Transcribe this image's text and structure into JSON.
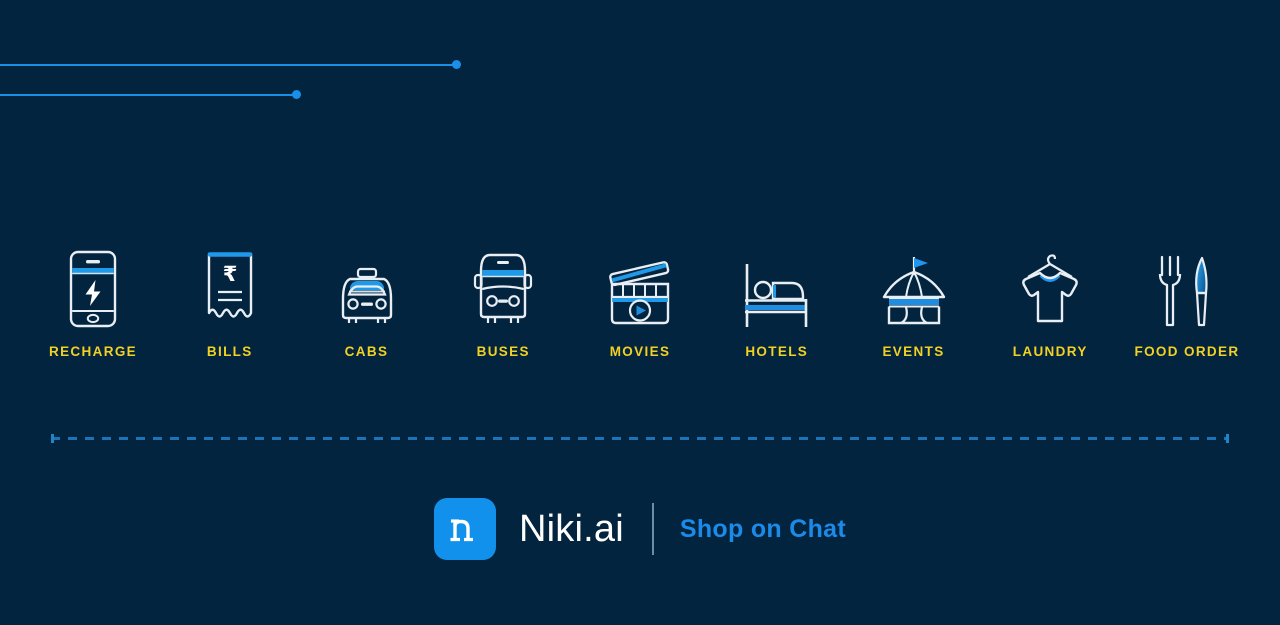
{
  "page": {
    "background_color": "#02243e",
    "accent_blue": "#1a8fe8",
    "label_yellow": "#f2d024",
    "icon_stroke": "#e8eef3"
  },
  "decor": {
    "top_lines": [
      {
        "name": "deco-line-1",
        "length": 455,
        "dot": true
      },
      {
        "name": "deco-line-2",
        "length": 294,
        "dot": true
      }
    ],
    "dashed_separator": {
      "name": "dashed-separator",
      "color": "#1c73b5"
    }
  },
  "services": [
    {
      "id": "recharge",
      "label": "RECHARGE",
      "icon": "mobile-phone-lightning-icon"
    },
    {
      "id": "bills",
      "label": "BILLS",
      "icon": "receipt-rupee-icon"
    },
    {
      "id": "cabs",
      "label": "CABS",
      "icon": "taxi-front-icon"
    },
    {
      "id": "buses",
      "label": "BUSES",
      "icon": "bus-front-icon"
    },
    {
      "id": "movies",
      "label": "MOVIES",
      "icon": "clapperboard-play-icon"
    },
    {
      "id": "hotels",
      "label": "HOTELS",
      "icon": "bed-person-icon"
    },
    {
      "id": "events",
      "label": "EVENTS",
      "icon": "circus-tent-flag-icon"
    },
    {
      "id": "laundry",
      "label": "LAUNDRY",
      "icon": "tshirt-hanger-icon"
    },
    {
      "id": "food_order",
      "label": "FOOD ORDER",
      "icon": "fork-knife-icon"
    }
  ],
  "brand": {
    "logo_glyph": "n",
    "logo_icon": "niki-n-mark-icon",
    "logo_bg": "#1191ec",
    "name": "Niki.ai",
    "tagline": "Shop on Chat",
    "tagline_color": "#1b8ae8"
  }
}
